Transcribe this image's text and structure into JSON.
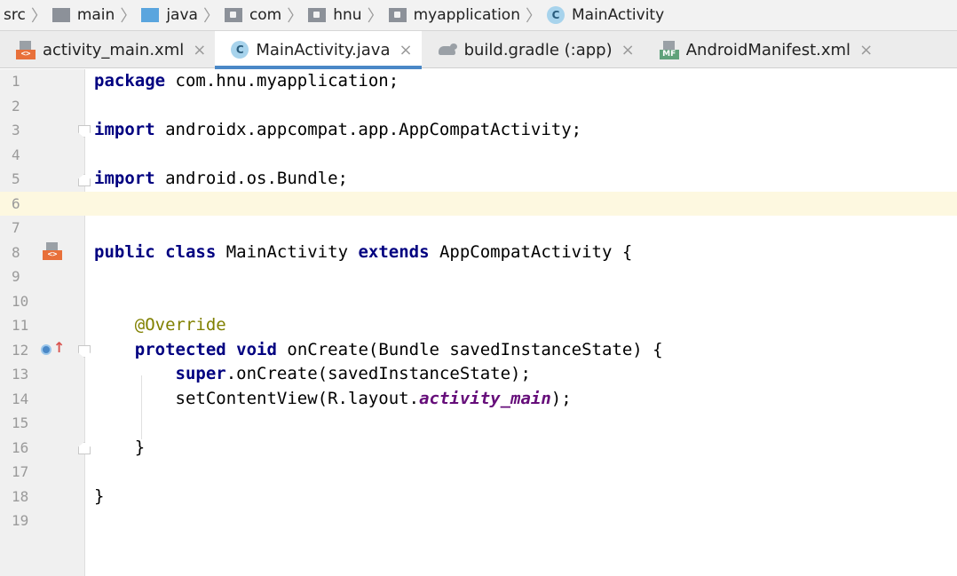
{
  "breadcrumb": {
    "items": [
      {
        "label": "src",
        "icon": "none"
      },
      {
        "label": "main",
        "icon": "folder-icon"
      },
      {
        "label": "java",
        "icon": "source-folder-icon"
      },
      {
        "label": "com",
        "icon": "package-icon"
      },
      {
        "label": "hnu",
        "icon": "package-icon"
      },
      {
        "label": "myapplication",
        "icon": "package-icon"
      },
      {
        "label": "MainActivity",
        "icon": "class-icon"
      }
    ],
    "class_icon_letter": "C"
  },
  "tabs": [
    {
      "label": "activity_main.xml",
      "icon": "xml-layout-icon",
      "badge": "<>",
      "active": false
    },
    {
      "label": "MainActivity.java",
      "icon": "class-icon",
      "badge": "C",
      "active": true
    },
    {
      "label": "build.gradle (:app)",
      "icon": "gradle-icon",
      "active": false
    },
    {
      "label": "AndroidManifest.xml",
      "icon": "manifest-icon",
      "badge": "MF",
      "active": false
    }
  ],
  "tab_close_glyph": "×",
  "editor": {
    "current_line": 6,
    "line_numbers": [
      "1",
      "2",
      "3",
      "4",
      "5",
      "6",
      "7",
      "8",
      "9",
      "10",
      "11",
      "12",
      "13",
      "14",
      "15",
      "16",
      "17",
      "18",
      "19"
    ],
    "lines": {
      "l1": {
        "kw": "package",
        "rest": " com.hnu.myapplication;"
      },
      "l3": {
        "kw": "import",
        "rest": " androidx.appcompat.app.AppCompatActivity;"
      },
      "l5": {
        "kw": "import",
        "rest": " android.os.Bundle;"
      },
      "l8": {
        "kw1": "public",
        "kw2": "class",
        "name": " MainActivity ",
        "kw3": "extends",
        "rest": " AppCompatActivity {"
      },
      "l11": {
        "annotation": "@Override"
      },
      "l12": {
        "kw1": "protected",
        "kw2": "void",
        "rest": " onCreate(Bundle savedInstanceState) {"
      },
      "l13": {
        "kw": "super",
        "rest": ".onCreate(savedInstanceState);"
      },
      "l14": {
        "pre": "setContentView(R.layout.",
        "italic": "activity_main",
        "post": ");"
      },
      "l16": {
        "text": "}"
      },
      "l18": {
        "text": "}"
      }
    },
    "gutter_icons": {
      "run_badge": "<>",
      "override_arrow": "↑"
    }
  },
  "colors": {
    "keyword": "#000080",
    "annotation": "#808000",
    "italic_field": "#660e7a",
    "current_line_bg": "#fdf8e0",
    "active_tab_underline": "#4a88c7"
  }
}
